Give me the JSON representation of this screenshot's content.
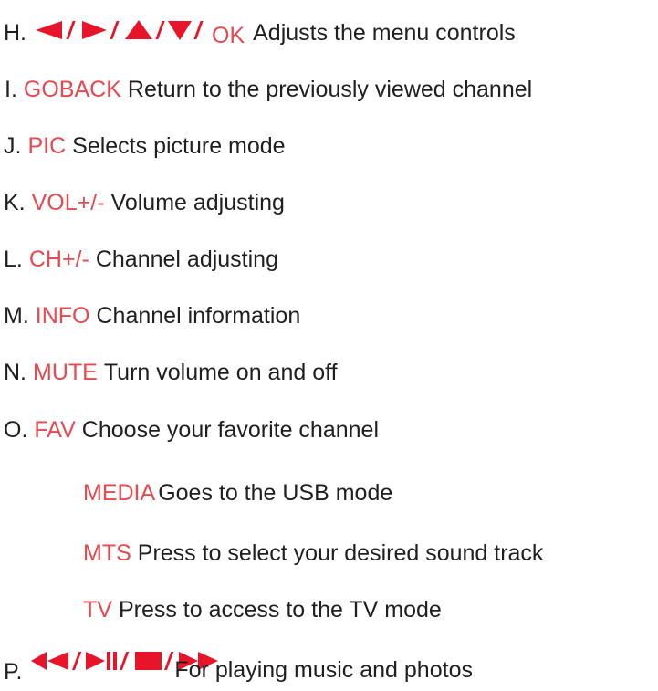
{
  "items": [
    {
      "letter": "H.",
      "key": "OK",
      "desc": "Adjusts the menu controls",
      "icons": [
        "left-arrow-icon",
        "right-arrow-icon",
        "up-arrow-icon",
        "down-arrow-icon"
      ]
    },
    {
      "letter": "I.",
      "key": "GOBACK",
      "desc": "Return to the previously viewed channel"
    },
    {
      "letter": "J.",
      "key": "PIC",
      "desc": "Selects picture mode"
    },
    {
      "letter": "K.",
      "key": "VOL+/-",
      "desc": "Volume adjusting"
    },
    {
      "letter": "L.",
      "key": "CH+/-",
      "desc": "Channel adjusting"
    },
    {
      "letter": "M.",
      "key": "INFO",
      "desc": "Channel information"
    },
    {
      "letter": "N.",
      "key": "MUTE",
      "desc": "Turn volume on and off"
    },
    {
      "letter": "O.",
      "key": "FAV",
      "desc": "Choose your favorite channel"
    },
    {
      "letter": "",
      "key": "MEDIA",
      "desc": "Goes to the USB mode"
    },
    {
      "letter": "",
      "key": "MTS",
      "desc": "Press to select your desired sound track"
    },
    {
      "letter": "",
      "key": "TV",
      "desc": "Press to access to the TV mode"
    },
    {
      "letter": "P.",
      "key": "",
      "desc": "For playing music and photos",
      "icons": [
        "rewind-icon",
        "play-pause-icon",
        "stop-icon",
        "fast-forward-icon"
      ]
    }
  ],
  "colors": {
    "key_text": "#e8484f",
    "icon_fill": "#e8152a",
    "body_text": "#1f1f1f"
  }
}
